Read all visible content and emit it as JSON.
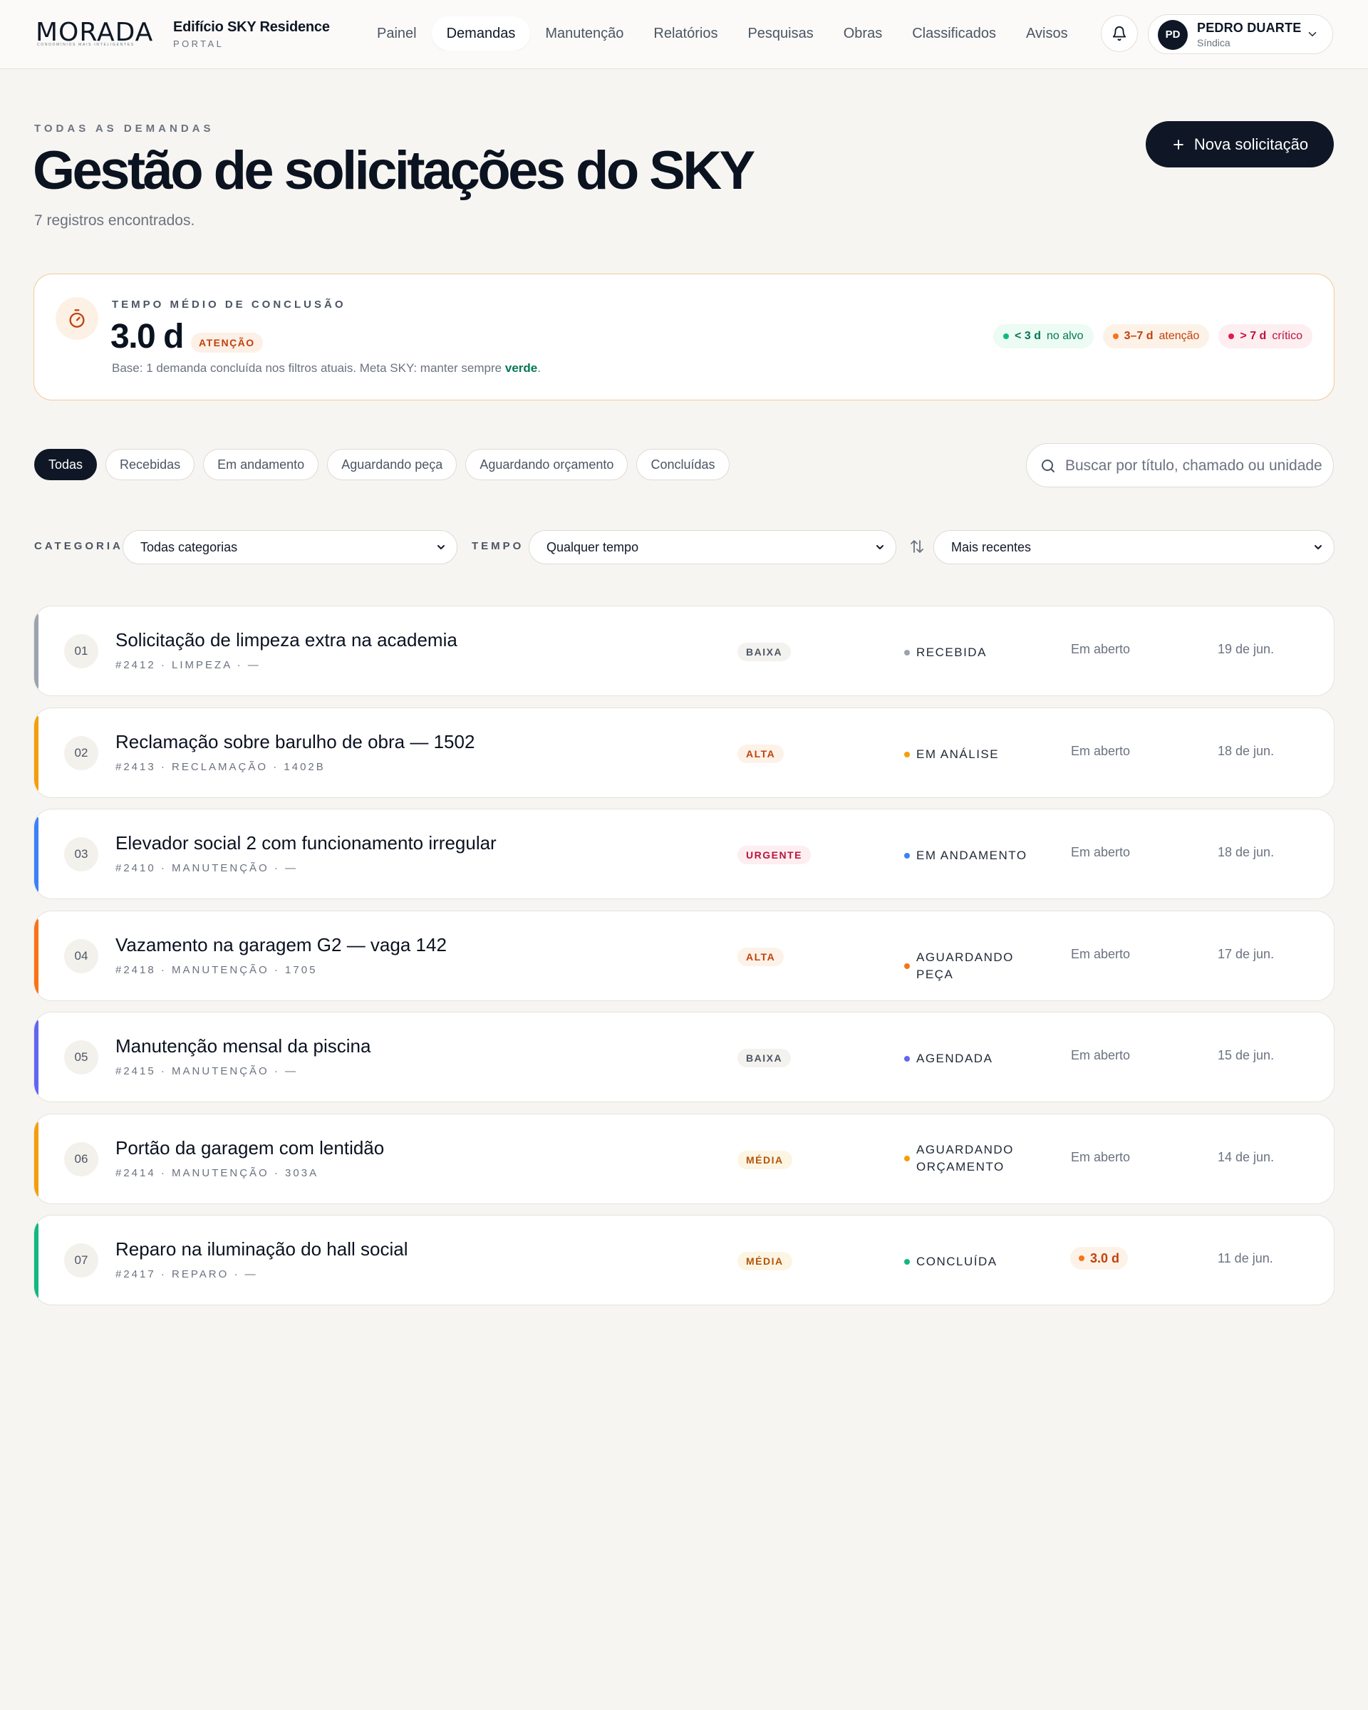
{
  "brand": {
    "logo_text": "MORADA",
    "logo_tagline": "CONDOMÍNIOS MAIS INTELIGENTES",
    "building": "Edifício SKY Residence",
    "portal": "PORTAL"
  },
  "nav": {
    "items": [
      "Painel",
      "Demandas",
      "Manutenção",
      "Relatórios",
      "Pesquisas",
      "Obras",
      "Classificados",
      "Avisos"
    ],
    "active": "Demandas"
  },
  "user": {
    "initials": "PD",
    "name": "PEDRO DUARTE",
    "role": "Síndica"
  },
  "header": {
    "eyebrow": "TODAS AS DEMANDAS",
    "title": "Gestão de solicitações do SKY",
    "subtitle": "7 registros encontrados.",
    "new_button": "Nova solicitação"
  },
  "kpi": {
    "label": "TEMPO MÉDIO DE CONCLUSÃO",
    "value": "3.0 d",
    "badge": "ATENÇÃO",
    "note_prefix": "Base: 1 demanda concluída nos filtros atuais. Meta SKY: manter sempre ",
    "note_highlight": "verde",
    "note_suffix": ".",
    "legend": [
      {
        "range": "< 3 d",
        "label": "no alvo",
        "color": "#10b981"
      },
      {
        "range": "3–7 d",
        "label": "atenção",
        "color": "#f97316"
      },
      {
        "range": "> 7 d",
        "label": "crítico",
        "color": "#e11d48"
      }
    ]
  },
  "tabs": [
    "Todas",
    "Recebidas",
    "Em andamento",
    "Aguardando peça",
    "Aguardando orçamento",
    "Concluídas"
  ],
  "search": {
    "placeholder": "Buscar por título, chamado ou unidade"
  },
  "filters": {
    "category_label": "CATEGORIA",
    "category_value": "Todas categorias",
    "time_label": "TEMPO",
    "time_value": "Qualquer tempo",
    "sort_value": "Mais recentes"
  },
  "colors": {
    "recebida": "#9ca3af",
    "em_analise": "#f59e0b",
    "em_andamento": "#3b82f6",
    "aguardando_peca": "#f97316",
    "agendada": "#6366f1",
    "aguardando_orcamento": "#f59e0b",
    "concluida": "#10b981"
  },
  "demands": [
    {
      "num": "01",
      "title": "Solicitação de limpeza extra na academia",
      "meta": "#2412 · LIMPEZA · —",
      "priority": "BAIXA",
      "status": "RECEBIDA",
      "time": "Em aberto",
      "date": "19 de jun."
    },
    {
      "num": "02",
      "title": "Reclamação sobre barulho de obra — 1502",
      "meta": "#2413 · RECLAMAÇÃO · 1402B",
      "priority": "ALTA",
      "status": "EM ANÁLISE",
      "time": "Em aberto",
      "date": "18 de jun."
    },
    {
      "num": "03",
      "title": "Elevador social 2 com funcionamento irregular",
      "meta": "#2410 · MANUTENÇÃO · —",
      "priority": "URGENTE",
      "status": "EM ANDAMENTO",
      "time": "Em aberto",
      "date": "18 de jun."
    },
    {
      "num": "04",
      "title": "Vazamento na garagem G2 — vaga 142",
      "meta": "#2418 · MANUTENÇÃO · 1705",
      "priority": "ALTA",
      "status": "AGUARDANDO PEÇA",
      "time": "Em aberto",
      "date": "17 de jun."
    },
    {
      "num": "05",
      "title": "Manutenção mensal da piscina",
      "meta": "#2415 · MANUTENÇÃO · —",
      "priority": "BAIXA",
      "status": "AGENDADA",
      "time": "Em aberto",
      "date": "15 de jun."
    },
    {
      "num": "06",
      "title": "Portão da garagem com lentidão",
      "meta": "#2414 · MANUTENÇÃO · 303A",
      "priority": "MÉDIA",
      "status": "AGUARDANDO ORÇAMENTO",
      "time": "Em aberto",
      "date": "14 de jun."
    },
    {
      "num": "07",
      "title": "Reparo na iluminação do hall social",
      "meta": "#2417 · REPARO · —",
      "priority": "MÉDIA",
      "status": "CONCLUÍDA",
      "time": "3.0 d",
      "date": "11 de jun."
    }
  ]
}
